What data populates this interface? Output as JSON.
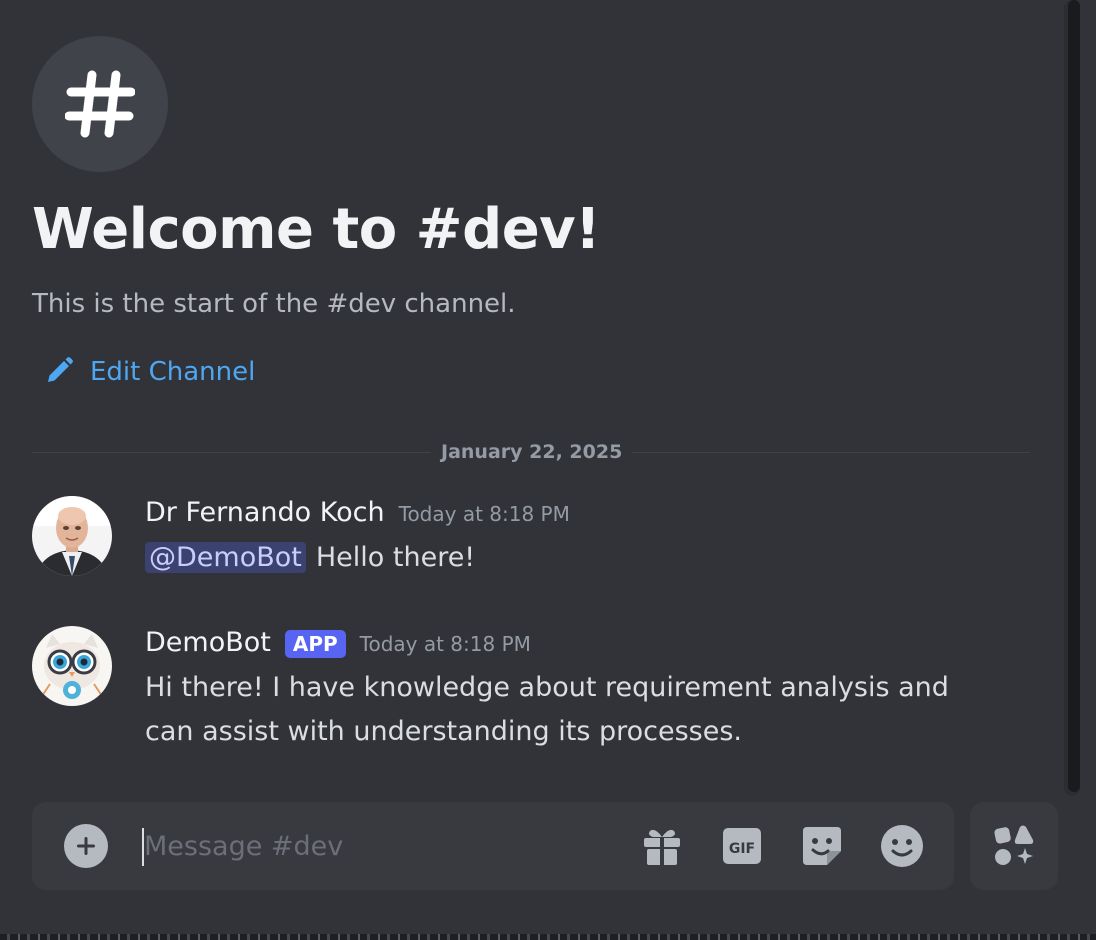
{
  "channel": {
    "name": "#dev",
    "icon": "hashtag-icon",
    "welcome_title": "Welcome to #dev!",
    "welcome_subtitle": "This is the start of the #dev channel.",
    "edit_label": "Edit Channel"
  },
  "date_divider": "January 22, 2025",
  "messages": [
    {
      "author": "Dr Fernando Koch",
      "timestamp": "Today at 8:18 PM",
      "mention": "@DemoBot",
      "text": "Hello there!"
    },
    {
      "author": "DemoBot",
      "badge": "APP",
      "timestamp": "Today at 8:18 PM",
      "text_line1": "Hi there! I have knowledge about requirement analysis and",
      "text_line2": "can assist with understanding its processes."
    }
  ],
  "composer": {
    "placeholder": "Message #dev",
    "value": "",
    "buttons": [
      "plus-circle-icon",
      "gift-icon",
      "gif-icon",
      "sticker-icon",
      "emoji-icon",
      "apps-icon"
    ]
  },
  "colors": {
    "background": "#313338",
    "link": "#4ea7f2",
    "app_badge": "#5865f2",
    "mention_bg": "#3c4270"
  }
}
